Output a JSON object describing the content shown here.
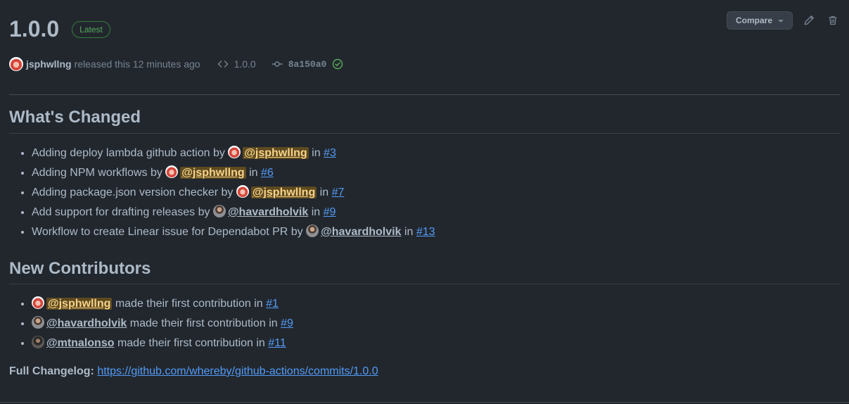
{
  "release": {
    "title": "1.0.0",
    "badge": "Latest",
    "compare_label": "Compare",
    "author": "jsphwllng",
    "released_text": "released this 12 minutes ago",
    "tag": "1.0.0",
    "commit": "8a150a0"
  },
  "sections": {
    "changed_heading": "What's Changed",
    "contributors_heading": "New Contributors"
  },
  "changes": [
    {
      "text": "Adding deploy lambda github action by",
      "user": "@jsphwllng",
      "in": "in",
      "pr": "#3"
    },
    {
      "text": "Adding NPM workflows by",
      "user": "@jsphwllng",
      "in": "in",
      "pr": "#6"
    },
    {
      "text": "Adding package.json version checker by",
      "user": "@jsphwllng",
      "in": "in",
      "pr": "#7"
    },
    {
      "text": "Add support for drafting releases by",
      "user": "@havardholvik",
      "in": "in",
      "pr": "#9"
    },
    {
      "text": "Workflow to create Linear issue for Dependabot PR by",
      "user": "@havardholvik",
      "in": "in",
      "pr": "#13"
    }
  ],
  "contributors": [
    {
      "user": "@jsphwllng",
      "text": "made their first contribution in",
      "pr": "#1"
    },
    {
      "user": "@havardholvik",
      "text": "made their first contribution in",
      "pr": "#9"
    },
    {
      "user": "@mtnalonso",
      "text": "made their first contribution in",
      "pr": "#11"
    }
  ],
  "changelog": {
    "label": "Full Changelog:",
    "url": "https://github.com/whereby/github-actions/commits/1.0.0"
  },
  "colors": {
    "background": "#22272e",
    "text": "#adbac7",
    "link": "#539bf5",
    "badge_green": "#57ab5a",
    "mention_highlight": "#5e4a1f"
  }
}
